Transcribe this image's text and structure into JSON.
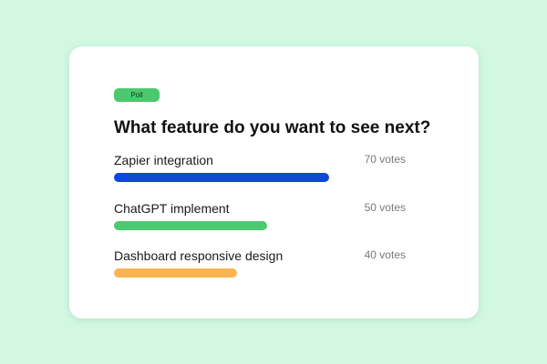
{
  "poll": {
    "badge": "Poll",
    "question": "What feature do you want to see next?",
    "max_votes": 95,
    "options": [
      {
        "label": "Zapier integration",
        "votes_text": "70 votes",
        "votes": 70,
        "color": "#0e48d6"
      },
      {
        "label": "ChatGPT implement",
        "votes_text": "50 votes",
        "votes": 50,
        "color": "#4cc96f"
      },
      {
        "label": "Dashboard responsive design",
        "votes_text": "40 votes",
        "votes": 40,
        "color": "#fbb44f"
      }
    ]
  },
  "colors": {
    "background": "#d3f8e2",
    "card": "#ffffff",
    "badge": "#4cc96f"
  }
}
